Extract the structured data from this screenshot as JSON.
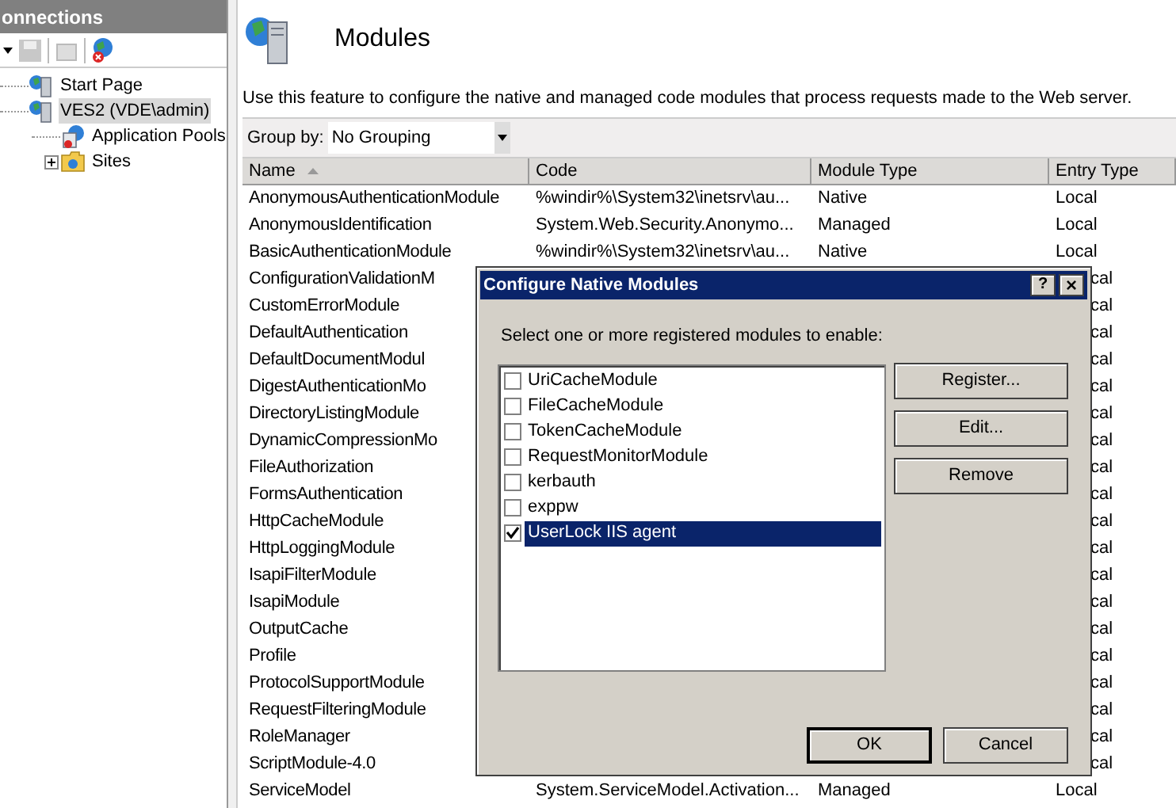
{
  "connections": {
    "title": "onnections",
    "tree": [
      {
        "label": "Start Page",
        "selected": false
      },
      {
        "label": "VES2 (VDE\\admin)",
        "selected": true,
        "children": [
          {
            "label": "Application Pools",
            "selected": false
          },
          {
            "label": "Sites",
            "selected": false,
            "expanded": false
          }
        ]
      }
    ]
  },
  "page": {
    "title": "Modules",
    "description": "Use this feature to configure the native and managed code modules that process requests made to the Web server.",
    "group_by": {
      "label": "Group by:",
      "value": "No Grouping"
    },
    "table": {
      "columns": [
        "Name",
        "Code",
        "Module Type",
        "Entry Type"
      ],
      "rows": [
        {
          "kind": "full",
          "name": "AnonymousAuthenticationModule",
          "code": "%windir%\\System32\\inetsrv\\au...",
          "module_type": "Native",
          "entry_type": "Local"
        },
        {
          "kind": "full",
          "name": "AnonymousIdentification",
          "code": "System.Web.Security.Anonymo...",
          "module_type": "Managed",
          "entry_type": "Local"
        },
        {
          "kind": "full",
          "name": "BasicAuthenticationModule",
          "code": "%windir%\\System32\\inetsrv\\au...",
          "module_type": "Native",
          "entry_type": "Local"
        },
        {
          "kind": "covered",
          "name": "ConfigurationValidationM",
          "entry_type": "cal"
        },
        {
          "kind": "covered",
          "name": "CustomErrorModule",
          "entry_type": "cal"
        },
        {
          "kind": "covered",
          "name": "DefaultAuthentication",
          "entry_type": "cal"
        },
        {
          "kind": "covered",
          "name": "DefaultDocumentModul",
          "entry_type": "cal"
        },
        {
          "kind": "covered",
          "name": "DigestAuthenticationMo",
          "entry_type": "cal"
        },
        {
          "kind": "covered",
          "name": "DirectoryListingModule",
          "entry_type": "cal"
        },
        {
          "kind": "covered",
          "name": "DynamicCompressionMo",
          "entry_type": "cal"
        },
        {
          "kind": "covered",
          "name": "FileAuthorization",
          "entry_type": "cal"
        },
        {
          "kind": "covered",
          "name": "FormsAuthentication",
          "entry_type": "cal"
        },
        {
          "kind": "covered",
          "name": "HttpCacheModule",
          "entry_type": "cal"
        },
        {
          "kind": "covered",
          "name": "HttpLoggingModule",
          "entry_type": "cal"
        },
        {
          "kind": "covered",
          "name": "IsapiFilterModule",
          "entry_type": "cal"
        },
        {
          "kind": "covered",
          "name": "IsapiModule",
          "entry_type": "cal"
        },
        {
          "kind": "covered",
          "name": "OutputCache",
          "entry_type": "cal"
        },
        {
          "kind": "covered",
          "name": "Profile",
          "entry_type": "cal"
        },
        {
          "kind": "covered",
          "name": "ProtocolSupportModule",
          "entry_type": "cal"
        },
        {
          "kind": "covered",
          "name": "RequestFilteringModule",
          "entry_type": "cal"
        },
        {
          "kind": "covered",
          "name": "RoleManager",
          "entry_type": "cal"
        },
        {
          "kind": "covered",
          "name": "ScriptModule-4.0",
          "entry_type": "cal"
        },
        {
          "kind": "full",
          "name": "ServiceModel",
          "code": "System.ServiceModel.Activation...",
          "module_type": "Managed",
          "entry_type": "Local"
        }
      ]
    }
  },
  "dialog": {
    "title": "Configure Native Modules",
    "help": "?",
    "close": "×",
    "instruction": "Select one or more registered modules to enable:",
    "modules": [
      {
        "label": "UriCacheModule",
        "checked": false,
        "selected": false
      },
      {
        "label": "FileCacheModule",
        "checked": false,
        "selected": false
      },
      {
        "label": "TokenCacheModule",
        "checked": false,
        "selected": false
      },
      {
        "label": "RequestMonitorModule",
        "checked": false,
        "selected": false
      },
      {
        "label": "kerbauth",
        "checked": false,
        "selected": false
      },
      {
        "label": "exppw",
        "checked": false,
        "selected": false
      },
      {
        "label": "UserLock IIS agent",
        "checked": true,
        "selected": true
      }
    ],
    "side_buttons": [
      "Register...",
      "Edit...",
      "Remove"
    ],
    "buttons": [
      {
        "label": "OK",
        "default": true
      },
      {
        "label": "Cancel",
        "default": false
      }
    ]
  }
}
